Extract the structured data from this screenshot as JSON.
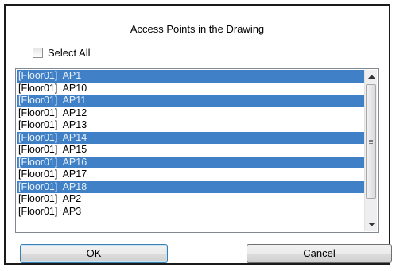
{
  "dialog": {
    "title": "Access Points in the Drawing",
    "select_all_label": "Select All",
    "select_all_checked": false
  },
  "list": {
    "items": [
      {
        "label": "[Floor01]  AP1",
        "selected": true
      },
      {
        "label": "[Floor01]  AP10",
        "selected": false
      },
      {
        "label": "[Floor01]  AP11",
        "selected": true
      },
      {
        "label": "[Floor01]  AP12",
        "selected": false
      },
      {
        "label": "[Floor01]  AP13",
        "selected": false
      },
      {
        "label": "[Floor01]  AP14",
        "selected": true
      },
      {
        "label": "[Floor01]  AP15",
        "selected": false
      },
      {
        "label": "[Floor01]  AP16",
        "selected": true
      },
      {
        "label": "[Floor01]  AP17",
        "selected": false
      },
      {
        "label": "[Floor01]  AP18",
        "selected": true
      },
      {
        "label": "[Floor01]  AP2",
        "selected": false
      },
      {
        "label": "[Floor01]  AP3",
        "selected": false
      }
    ],
    "selection_color": "#3f80c6"
  },
  "buttons": {
    "ok_label": "OK",
    "cancel_label": "Cancel"
  }
}
